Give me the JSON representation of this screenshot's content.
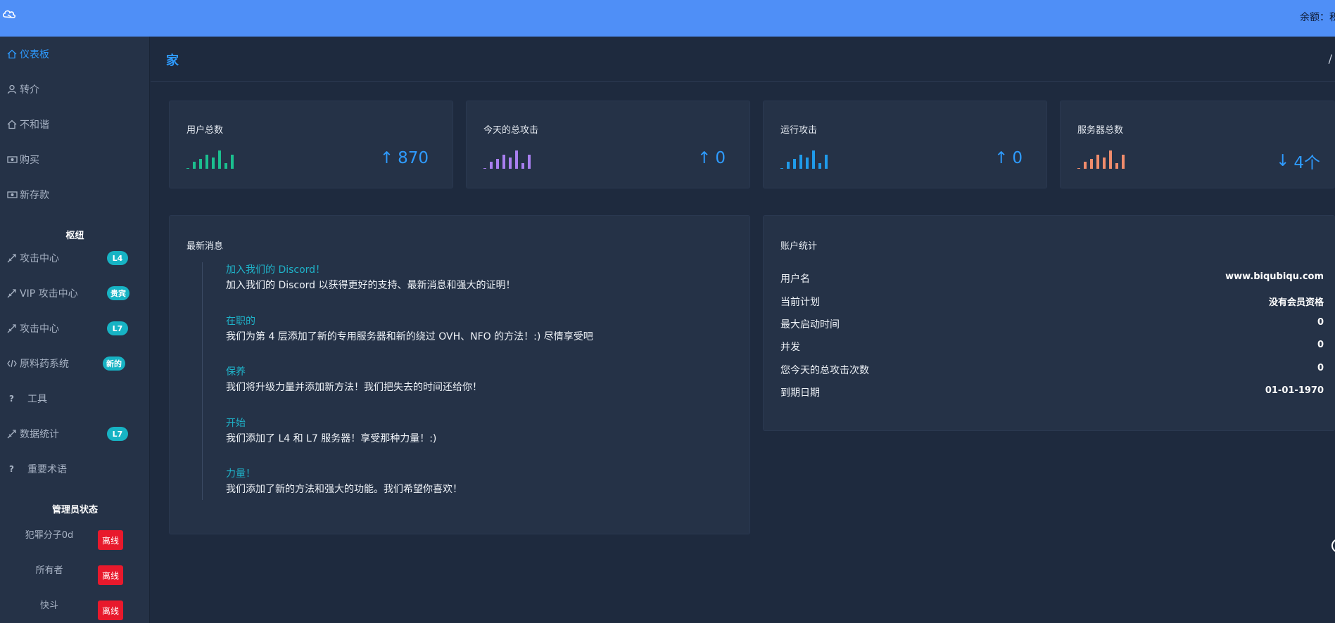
{
  "topbar": {
    "logo_icon": "cloud-link-icon",
    "balance_label": "余额：积"
  },
  "sidebar": {
    "items": [
      {
        "label": "仪表板",
        "icon": "home-icon",
        "active": true
      },
      {
        "label": "转介",
        "icon": "user-icon"
      },
      {
        "label": "不和谐",
        "icon": "home-icon"
      },
      {
        "label": "购买",
        "icon": "money-icon"
      },
      {
        "label": "新存款",
        "icon": "money-icon"
      }
    ],
    "hub_header": "枢纽",
    "hub_items": [
      {
        "label": "攻击中心",
        "icon": "rocket-icon",
        "badge": "L4"
      },
      {
        "label": "VIP 攻击中心",
        "icon": "rocket-icon",
        "badge": "贵宾"
      },
      {
        "label": "攻击中心",
        "icon": "rocket-icon",
        "badge": "L7"
      },
      {
        "label": "原料药系统",
        "icon": "code-icon",
        "badge": "新的"
      },
      {
        "label": "工具",
        "icon": "question-icon"
      },
      {
        "label": "数据统计",
        "icon": "rocket-icon",
        "badge": "L7"
      },
      {
        "label": "重要术语",
        "icon": "question-icon"
      }
    ],
    "admin_header": "管理员状态",
    "admins": [
      {
        "name": "犯罪分子0d",
        "status": "离线"
      },
      {
        "name": "所有者",
        "status": "离线"
      },
      {
        "name": "快斗",
        "status": "离线"
      }
    ]
  },
  "header": {
    "title": "家",
    "breadcrumb_separator": "/"
  },
  "stats": [
    {
      "title": "用户总数",
      "value": "870",
      "direction": "up",
      "arrow": "↑",
      "color": "#1bbf8f"
    },
    {
      "title": "今天的总攻击",
      "value": "0",
      "direction": "up",
      "arrow": "↑",
      "color": "#a97ff0"
    },
    {
      "title": "运行攻击",
      "value": "0",
      "direction": "up",
      "arrow": "↑",
      "color": "#1f9bea"
    },
    {
      "title": "服务器总数",
      "value": "4个",
      "direction": "down",
      "arrow": "↓",
      "color": "#f08c6c"
    }
  ],
  "news": {
    "title": "最新消息",
    "items": [
      {
        "title": "加入我们的 Discord！",
        "text": "加入我们的 Discord 以获得更好的支持、最新消息和强大的证明！"
      },
      {
        "title": "在职的",
        "text": "我们为第 4 层添加了新的专用服务器和新的绕过 OVH、NFO 的方法！:) 尽情享受吧"
      },
      {
        "title": "保养",
        "text": "我们将升级力量并添加新方法！我们把失去的时间还给你！"
      },
      {
        "title": "开始",
        "text": "我们添加了 L4 和 L7 服务器！享受那种力量！:)"
      },
      {
        "title": "力量！",
        "text": "我们添加了新的方法和强大的功能。我们希望你喜欢！"
      }
    ]
  },
  "account": {
    "title": "账户统计",
    "rows": [
      {
        "label": "用户名",
        "value": "www.biqubiqu.com"
      },
      {
        "label": "当前计划",
        "value": "没有会员资格"
      },
      {
        "label": "最大启动时间",
        "value": "0"
      },
      {
        "label": "并发",
        "value": "0"
      },
      {
        "label": "您今天的总攻击次数",
        "value": "0"
      },
      {
        "label": "到期日期",
        "value": "01-01-1970"
      }
    ]
  },
  "colors": {
    "topbar": "#4f8ff7",
    "accent": "#2e9bff",
    "badge": "#17b3c4",
    "offline": "#e8192c",
    "news_title": "#1fb3c9"
  }
}
